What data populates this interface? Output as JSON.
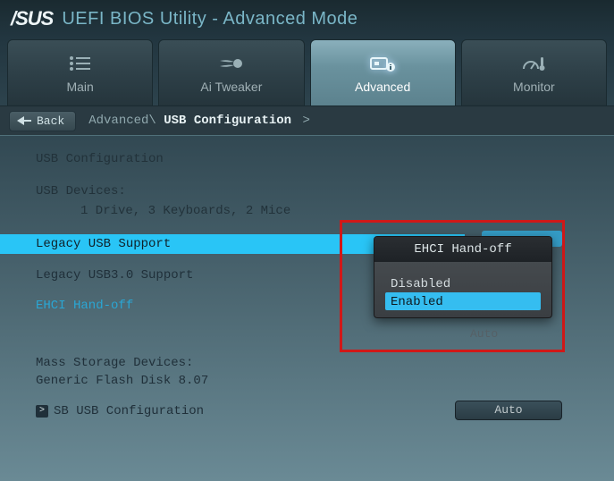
{
  "header": {
    "brand": "/SUS",
    "title": "UEFI BIOS Utility - Advanced Mode"
  },
  "tabs": {
    "main": "Main",
    "tweaker": "Ai Tweaker",
    "advanced": "Advanced",
    "monitor": "Monitor"
  },
  "back_label": "Back",
  "breadcrumb": {
    "root": "Advanced\\",
    "current": "USB Configuration",
    "sep": ">"
  },
  "section_title": "USB Configuration",
  "devices_label": "USB Devices:",
  "devices_value": "1 Drive, 3 Keyboards, 2 Mice",
  "opt_legacy_usb": "Legacy USB Support",
  "opt_legacy_usb3": "Legacy USB3.0 Support",
  "opt_ehci": "EHCI Hand-off",
  "mass_label": "Mass Storage Devices:",
  "mass_value": "Generic Flash Disk 8.07",
  "submenu_sb": "SB USB Configuration",
  "auto_label": "Auto",
  "popup": {
    "title": "EHCI Hand-off",
    "disabled": "Disabled",
    "enabled": "Enabled"
  },
  "ghost_auto": "Auto"
}
